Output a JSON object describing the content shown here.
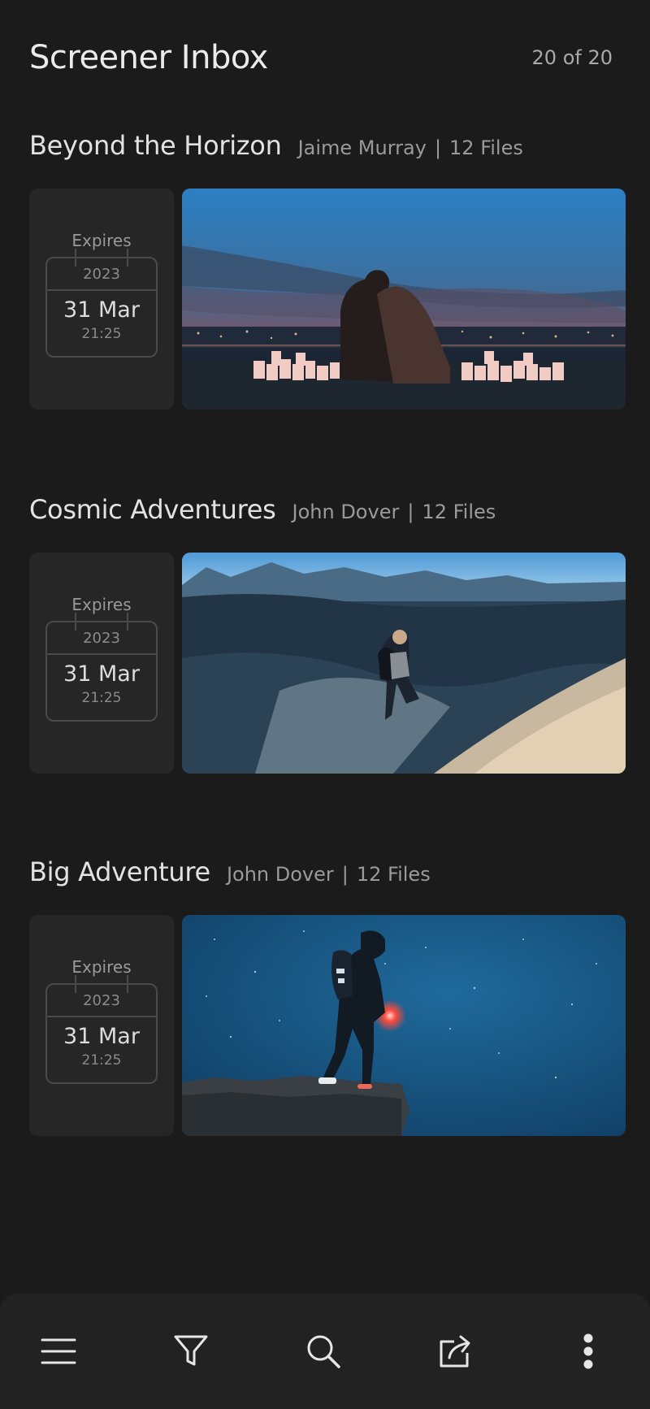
{
  "header": {
    "title": "Screener Inbox",
    "count": "20 of 20"
  },
  "items": [
    {
      "title": "Beyond the Horizon",
      "author": "Jaime Murray",
      "separator": "|",
      "files": "12 Files",
      "expires_label": "Expires",
      "year": "2023",
      "date": "31 Mar",
      "time": "21:25"
    },
    {
      "title": "Cosmic Adventures",
      "author": "John Dover",
      "separator": "|",
      "files": "12 Files",
      "expires_label": "Expires",
      "year": "2023",
      "date": "31 Mar",
      "time": "21:25"
    },
    {
      "title": "Big Adventure",
      "author": "John Dover",
      "separator": "|",
      "files": "12 Files",
      "expires_label": "Expires",
      "year": "2023",
      "date": "31 Mar",
      "time": "21:25"
    }
  ],
  "toolbar": [
    {
      "icon": "menu-icon"
    },
    {
      "icon": "filter-icon"
    },
    {
      "icon": "search-icon"
    },
    {
      "icon": "share-icon"
    },
    {
      "icon": "more-vertical-icon"
    }
  ],
  "colors": {
    "background": "#1b1b1b",
    "card": "#262626",
    "toolbar": "#222222",
    "muted_text": "#9a9a9a"
  }
}
